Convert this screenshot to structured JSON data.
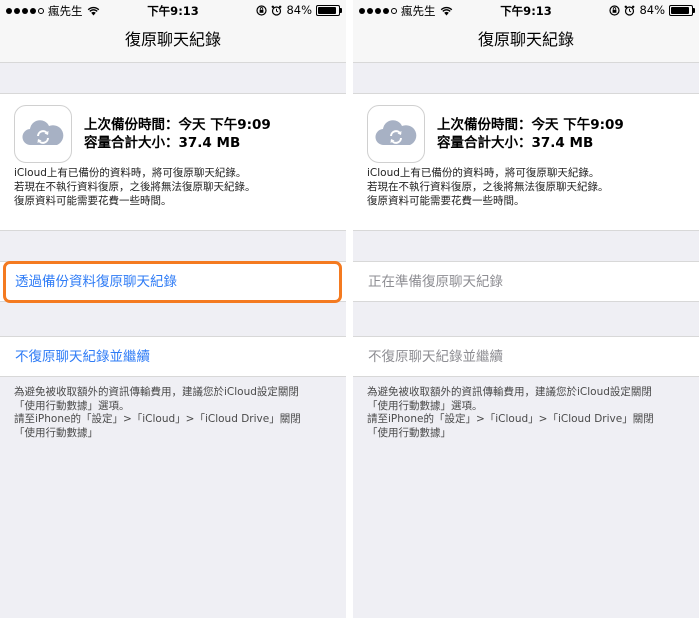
{
  "status_bar": {
    "carrier": "瘋先生",
    "time": "下午9:13",
    "battery": "84%",
    "battery_level": 0.84,
    "signal_bars": 4
  },
  "nav": {
    "title": "復原聊天紀錄"
  },
  "backup": {
    "last_backup": "上次備份時間：今天 下午9:09",
    "size": "容量合計大小：37.4 MB",
    "desc_lines": [
      "iCloud上有已備份的資料時，將可復原聊天紀錄。",
      "若現在不執行資料復原，之後將無法復原聊天紀錄。",
      "復原資料可能需要花費一些時間。"
    ]
  },
  "left": {
    "restore_label": "透過備份資料復原聊天紀錄",
    "skip_label": "不復原聊天紀錄並繼續"
  },
  "right": {
    "preparing_label": "正在準備復原聊天紀錄",
    "skip_label": "不復原聊天紀錄並繼續"
  },
  "footnote_lines": [
    "為避免被收取額外的資訊傳輸費用，建議您於iCloud設定關閉",
    "「使用行動數據」選項。",
    "請至iPhone的「設定」>「iCloud」>「iCloud Drive」關閉",
    "「使用行動數據」"
  ],
  "colors": {
    "link": "#2f7cf6",
    "disabled": "#8e8e93",
    "highlight": "#f47a20",
    "background": "#efeff4"
  },
  "icons": [
    "wifi-icon",
    "lock-rotation-icon",
    "alarm-icon",
    "battery-icon",
    "icloud-sync-icon"
  ]
}
